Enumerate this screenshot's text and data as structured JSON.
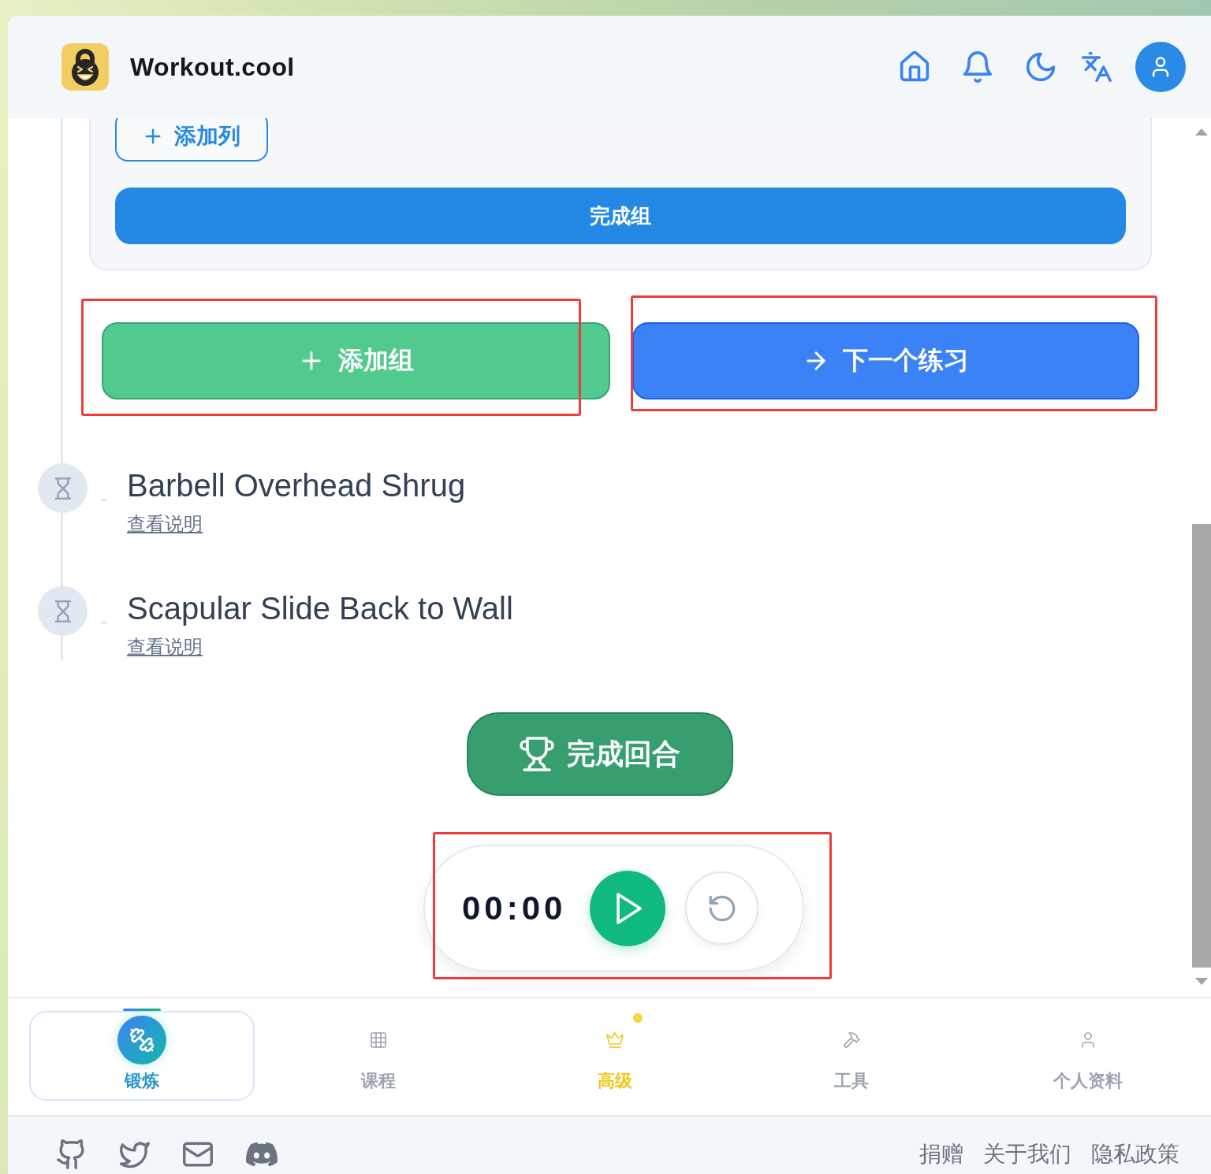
{
  "header": {
    "brand": "Workout.cool"
  },
  "exercise_card": {
    "add_column_button": "添加列",
    "complete_set_button": "完成组"
  },
  "actions": [
    {
      "kind": "add_set",
      "label": "添加组",
      "highlighted": true
    },
    {
      "kind": "next_exercise",
      "label": "下一个练习",
      "highlighted": true
    }
  ],
  "exercises": [
    {
      "name": "Barbell Overhead Shrug",
      "link": "查看说明"
    },
    {
      "name": "Scapular Slide Back to Wall",
      "link": "查看说明"
    }
  ],
  "complete_round_button": "完成回合",
  "timer": {
    "time": "00:00",
    "running": false,
    "highlighted": true
  },
  "bottom_nav": [
    {
      "kind": "workout",
      "label": "锻炼",
      "selected": true,
      "dot": false
    },
    {
      "kind": "programs",
      "label": "课程",
      "selected": false,
      "dot": false
    },
    {
      "kind": "premium",
      "label": "高级",
      "selected": false,
      "dot": true
    },
    {
      "kind": "tools",
      "label": "工具",
      "selected": false,
      "dot": false
    },
    {
      "kind": "profile",
      "label": "个人资料",
      "selected": false,
      "dot": false
    }
  ],
  "footer": {
    "links": [
      "捐赠",
      "关于我们",
      "隐私政策"
    ]
  }
}
